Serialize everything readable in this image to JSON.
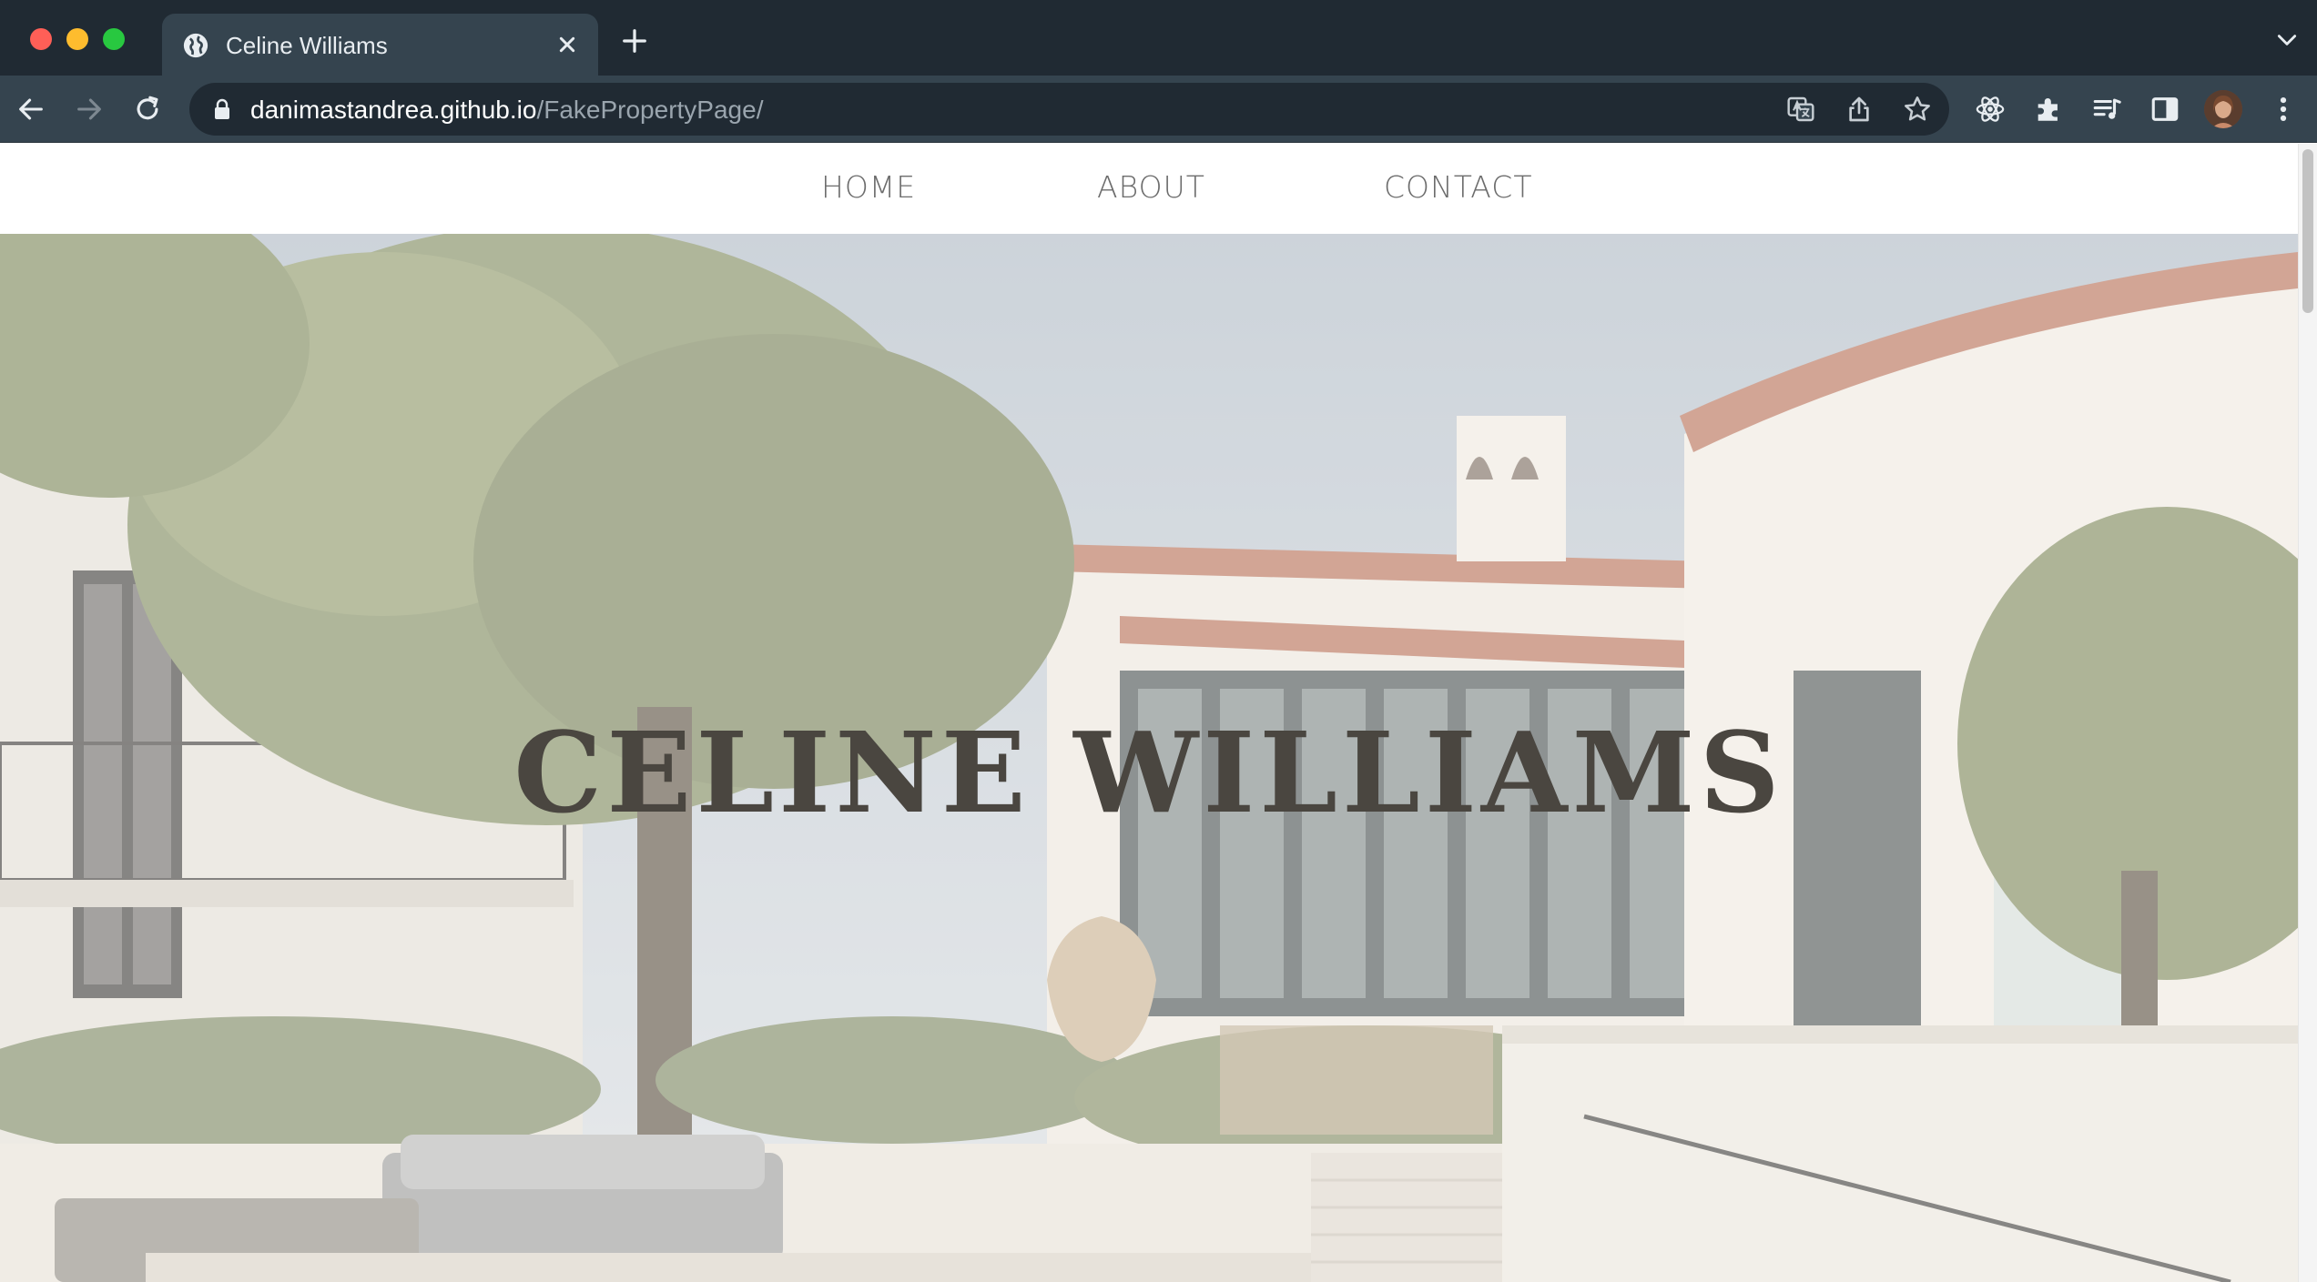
{
  "browser": {
    "tab_title": "Celine Williams",
    "url_host": "danimastandrea.github.io",
    "url_path": "/FakePropertyPage/"
  },
  "nav": {
    "items": [
      {
        "label": "HOME"
      },
      {
        "label": "ABOUT"
      },
      {
        "label": "CONTACT"
      }
    ]
  },
  "hero": {
    "title": "CELINE WILLIAMS",
    "image": "mediterranean-villa-courtyard-photo"
  },
  "colors": {
    "tabbar_bg": "#202a33",
    "toolbar_bg": "#35444f",
    "nav_text": "#6c6c6c",
    "hero_title": "#4a4640"
  }
}
